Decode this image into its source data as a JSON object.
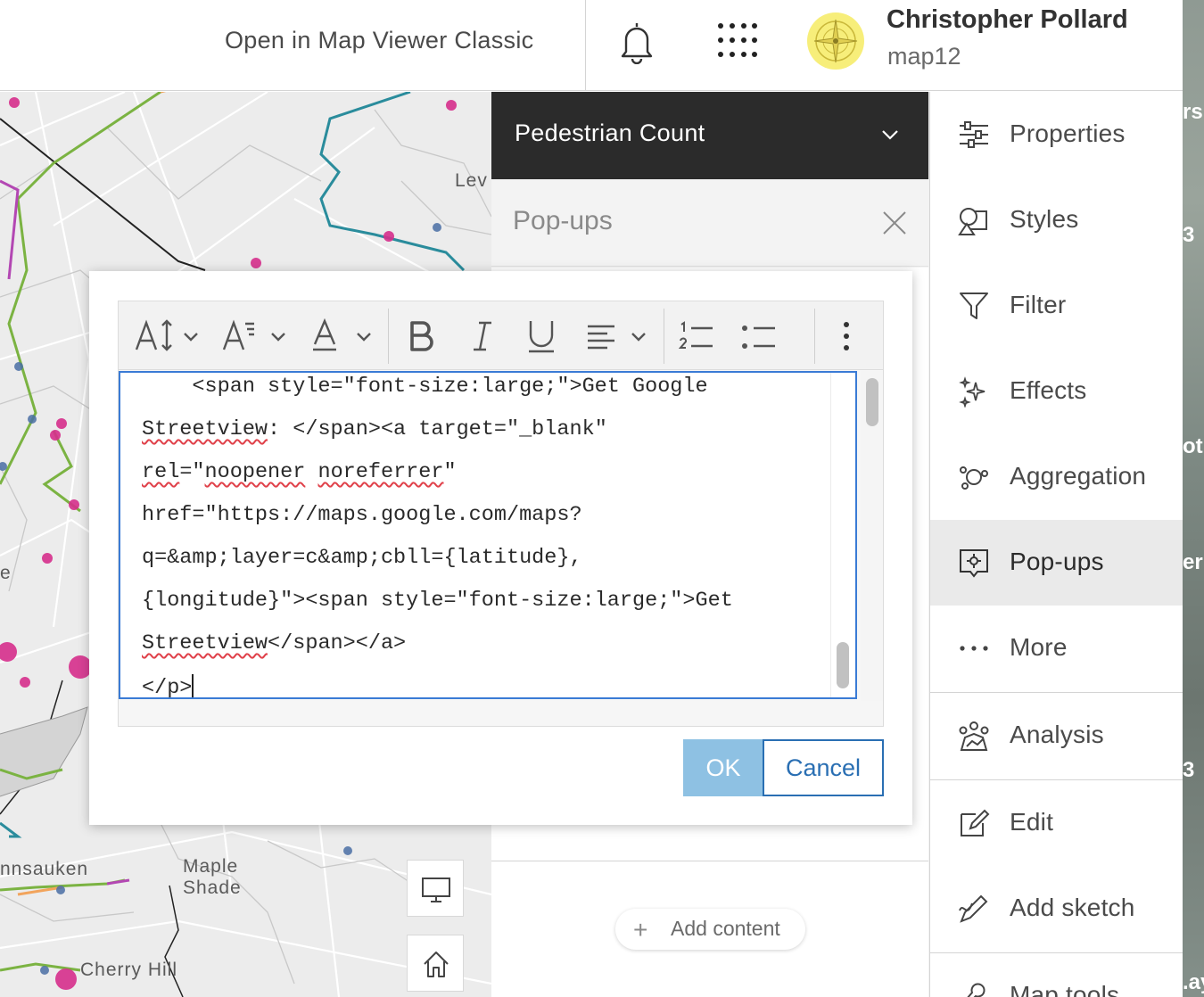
{
  "header": {
    "open_classic_label": "Open in Map Viewer Classic",
    "user_name": "Christopher Pollard",
    "user_org": "map12"
  },
  "map": {
    "labels": {
      "lev": "Lev",
      "pennsauken": "nnsauken",
      "maple_shade_1": "Maple",
      "maple_shade_2": "Shade",
      "cherry_hill": "Cherry Hill",
      "edge_e": "e"
    }
  },
  "layer": {
    "name": "Pedestrian Count"
  },
  "panel": {
    "title": "Pop-ups",
    "add_content_label": "Add content"
  },
  "nav": {
    "items": [
      {
        "label": "Properties",
        "icon": "sliders-icon"
      },
      {
        "label": "Styles",
        "icon": "styles-icon"
      },
      {
        "label": "Filter",
        "icon": "filter-icon"
      },
      {
        "label": "Effects",
        "icon": "sparkle-icon"
      },
      {
        "label": "Aggregation",
        "icon": "aggregation-icon"
      },
      {
        "label": "Pop-ups",
        "icon": "popup-icon",
        "active": true
      },
      {
        "label": "More",
        "icon": "ellipsis-icon"
      },
      {
        "label": "Analysis",
        "icon": "analysis-icon"
      },
      {
        "label": "Edit",
        "icon": "edit-icon"
      },
      {
        "label": "Add sketch",
        "icon": "sketch-icon"
      },
      {
        "label": "Map tools",
        "icon": "wrench-icon"
      }
    ]
  },
  "editor": {
    "lines": {
      "l1": "    <span style=\"font-size:large;\">Get Google",
      "l2a": "Streetview",
      "l2b": ": </span><a target=\"_blank\"",
      "l3a": "rel",
      "l3b": "=\"",
      "l3c": "noopener",
      "l3d": " ",
      "l3e": "noreferrer",
      "l3f": "\"",
      "l4": "href=\"https://maps.google.com/maps?",
      "l5": "q=&amp;layer=c&amp;cbll={latitude},",
      "l6": "{longitude}\"><span style=\"font-size:large;\">Get",
      "l7a": "Streetview",
      "l7b": "</span></a>",
      "l8": "</p>"
    }
  },
  "dialog": {
    "ok_label": "OK",
    "cancel_label": "Cancel"
  },
  "strip": {
    "t1": "rs",
    "t2": "3",
    "t3": "ot",
    "t4": "er",
    "t5": "3",
    "t6": ".ay"
  },
  "colors": {
    "accent": "#2a6fb3",
    "ok_disabled": "#8ec1e3",
    "header_dark": "#2b2b2b",
    "map_point_pink": "#d62f8c",
    "map_point_blue": "#4a6fa5",
    "route_green": "#7bb342",
    "route_teal": "#2a8c9c"
  }
}
